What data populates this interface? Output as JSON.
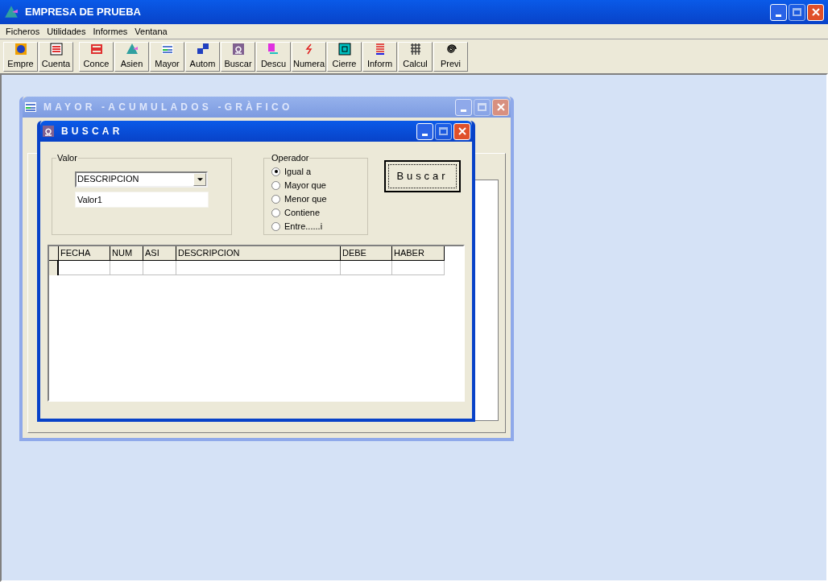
{
  "window": {
    "title": "EMPRESA DE PRUEBA"
  },
  "menu": [
    "Ficheros",
    "Utilidades",
    "Informes",
    "Ventana"
  ],
  "toolbar_groups": [
    [
      "Empre",
      "Cuenta"
    ],
    [
      "Conce",
      "Asien",
      "Mayor",
      "Autom",
      "Buscar",
      "Descu",
      "Numera",
      "Cierre",
      "Inform",
      "Calcul",
      "Previ"
    ]
  ],
  "mayor_window": {
    "title": "MAYOR -ACUMULADOS -GRÀFICO",
    "active": false
  },
  "buscar_dialog": {
    "title": "BUSCAR",
    "active": true,
    "valor": {
      "label": "Valor",
      "field": "DESCRIPCION",
      "value": "Valor1"
    },
    "operador": {
      "label": "Operador",
      "options": [
        {
          "label": "Igual a",
          "selected": true
        },
        {
          "label": "Mayor que",
          "selected": false
        },
        {
          "label": "Menor que",
          "selected": false
        },
        {
          "label": "Contiene",
          "selected": false
        },
        {
          "label": "Entre......i",
          "selected": false
        }
      ]
    },
    "button": "Buscar",
    "table": {
      "columns": [
        "FECHA",
        "NUM",
        "ASI",
        "DESCRIPCION",
        "DEBE",
        "HABER"
      ]
    }
  }
}
